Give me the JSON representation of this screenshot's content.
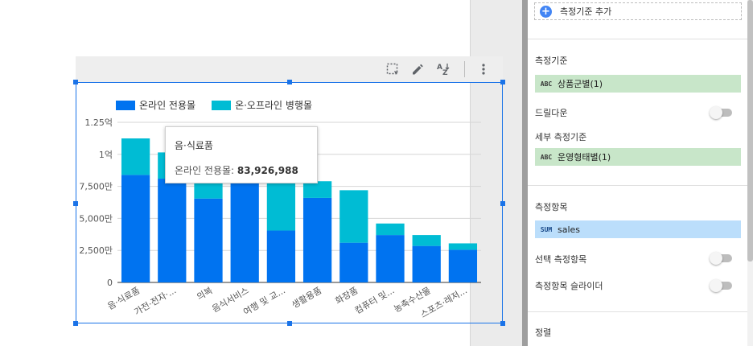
{
  "chart": {
    "legend": [
      {
        "label": "온라인 전용몰",
        "color": "#0073f0"
      },
      {
        "label": "온·오프라인 병행몰",
        "color": "#00bcd4"
      }
    ],
    "tooltip": {
      "title": "음·식료품",
      "series_label": "온라인 전용몰: ",
      "value": "83,926,988"
    }
  },
  "chart_data": {
    "type": "bar",
    "stacked": true,
    "categories": [
      "음·식료품",
      "가전·전자·...",
      "의복",
      "음식서비스",
      "여행 및 교...",
      "생활용품",
      "화장품",
      "컴퓨터 및...",
      "농축수산물",
      "스포츠·레저..."
    ],
    "series": [
      {
        "name": "온라인 전용몰",
        "values": [
          83926988,
          81000000,
          65500000,
          79000000,
          40500000,
          66000000,
          31000000,
          37000000,
          28500000,
          25500000
        ]
      },
      {
        "name": "온·오프라인 병행몰",
        "values": [
          28500000,
          20500000,
          17500000,
          4000000,
          37000000,
          13000000,
          41000000,
          9000000,
          8500000,
          5000000
        ]
      }
    ],
    "y_ticks": [
      "0",
      "2,500만",
      "5,000만",
      "7,500만",
      "1억",
      "1.25억"
    ],
    "ylim": [
      0,
      125000000
    ],
    "grid": true,
    "legend_position": "top-left"
  },
  "panel": {
    "add_dimension_label": "측정기준 추가",
    "dimension_section": "측정기준",
    "dimension_chip": {
      "type": "ABC",
      "label": "상품군별(1)"
    },
    "drilldown_label": "드릴다운",
    "breakdown_section": "세부 측정기준",
    "breakdown_chip": {
      "type": "ABC",
      "label": "운영형태별(1)"
    },
    "metric_section": "측정항목",
    "metric_chip": {
      "type": "SUM",
      "label": "sales"
    },
    "optional_metrics_label": "선택 측정항목",
    "metric_slider_label": "측정항목 슬라이더",
    "sort_label": "정렬"
  }
}
